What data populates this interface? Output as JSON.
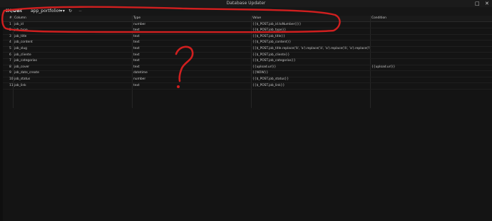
{
  "window": {
    "title": "Database Updater",
    "minimize": "□",
    "close": "✕"
  },
  "toolbar": {
    "root": "IM/DBt",
    "database": "app_portfolio ▾",
    "add": "+ ▾",
    "refresh": "↻",
    "remove": "−"
  },
  "columns": [
    "#",
    "Column",
    "Type",
    "Value",
    "Condition"
  ],
  "rows": [
    {
      "n": "1",
      "col": "job_id",
      "type": "number",
      "value": "{{$_POST.job_id.toNumber()}}",
      "cond": ""
    },
    {
      "n": "2",
      "col": "job_type",
      "type": "text",
      "value": "{{$_POST.job_type}}",
      "cond": ""
    },
    {
      "n": "3",
      "col": "job_title",
      "type": "text",
      "value": "{{$_POST.job_title}}",
      "cond": ""
    },
    {
      "n": "4",
      "col": "job_content",
      "type": "text",
      "value": "{{$_POST.job_content}}",
      "cond": ""
    },
    {
      "n": "5",
      "col": "job_slug",
      "type": "text",
      "value": "{{$_POST.job_title.replace('ã', 'a').replace('á', 'a').replace('â', 'a').replace('ì', 'i')...",
      "cond": ""
    },
    {
      "n": "6",
      "col": "job_cliente",
      "type": "text",
      "value": "{{$_POST.job_cliente}}",
      "cond": ""
    },
    {
      "n": "7",
      "col": "job_categorias",
      "type": "text",
      "value": "{{$_POST.job_categorias}}",
      "cond": ""
    },
    {
      "n": "8",
      "col": "job_cover",
      "type": "text",
      "value": "{{upload.url}}",
      "cond": "{{upload.url}}"
    },
    {
      "n": "9",
      "col": "job_date_create",
      "type": "datetime",
      "value": "{{NOW}}",
      "cond": ""
    },
    {
      "n": "10",
      "col": "job_status",
      "type": "number",
      "value": "{{$_POST.job_status}}",
      "cond": ""
    },
    {
      "n": "11",
      "col": "job_link",
      "type": "text",
      "value": "{{$_POST.job_link}}",
      "cond": ""
    }
  ],
  "annotation": {
    "question": "?"
  },
  "colors": {
    "annotation": "#d01f1f"
  }
}
